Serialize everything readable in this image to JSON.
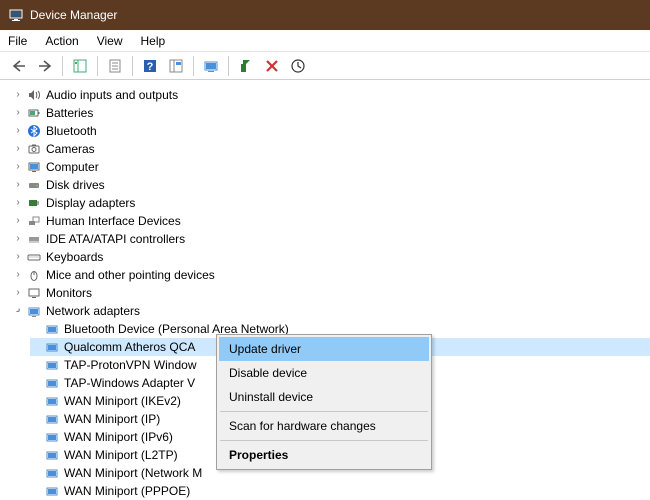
{
  "window": {
    "title": "Device Manager"
  },
  "menu": {
    "file": "File",
    "action": "Action",
    "view": "View",
    "help": "Help"
  },
  "categories": {
    "audio": "Audio inputs and outputs",
    "batteries": "Batteries",
    "bluetooth": "Bluetooth",
    "cameras": "Cameras",
    "computer": "Computer",
    "disk": "Disk drives",
    "display": "Display adapters",
    "hid": "Human Interface Devices",
    "ide": "IDE ATA/ATAPI controllers",
    "keyboards": "Keyboards",
    "mice": "Mice and other pointing devices",
    "monitors": "Monitors",
    "network": "Network adapters"
  },
  "network_items": {
    "bt": "Bluetooth Device (Personal Area Network)",
    "qca": "Qualcomm Atheros QCA",
    "tap1": "TAP-ProtonVPN Window",
    "tap2": "TAP-Windows Adapter V",
    "wan_ikev2": "WAN Miniport (IKEv2)",
    "wan_ip": "WAN Miniport (IP)",
    "wan_ipv6": "WAN Miniport (IPv6)",
    "wan_l2tp": "WAN Miniport (L2TP)",
    "wan_netmon": "WAN Miniport (Network M",
    "wan_pppoe": "WAN Miniport (PPPOE)"
  },
  "context_menu": {
    "update": "Update driver",
    "disable": "Disable device",
    "uninstall": "Uninstall device",
    "scan": "Scan for hardware changes",
    "properties": "Properties"
  }
}
